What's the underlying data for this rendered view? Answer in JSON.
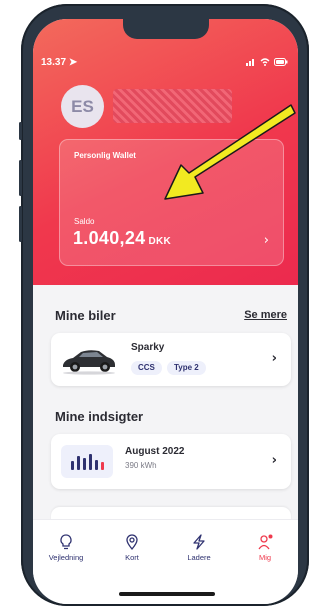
{
  "status": {
    "time": "13.37"
  },
  "profile": {
    "initials": "ES"
  },
  "wallet": {
    "title": "Personlig Wallet",
    "saldo_label": "Saldo",
    "amount": "1.040,24",
    "currency": "DKK"
  },
  "cars": {
    "section_title": "Mine biler",
    "see_more": "Se mere",
    "items": [
      {
        "name": "Sparky",
        "tags": [
          "CCS",
          "Type 2"
        ]
      }
    ]
  },
  "insights": {
    "section_title": "Mine indsigter",
    "items": [
      {
        "title": "August 2022",
        "subtitle": "390 kWh"
      }
    ]
  },
  "tabbar": {
    "items": [
      {
        "label": "Vejledning",
        "icon": "lightbulb-icon"
      },
      {
        "label": "Kort",
        "icon": "map-pin-icon"
      },
      {
        "label": "Ladere",
        "icon": "lightning-icon"
      },
      {
        "label": "Mig",
        "icon": "profile-icon"
      }
    ]
  },
  "colors": {
    "accent": "#ef3a4d",
    "nav": "#2f3270",
    "annotation_arrow": "#f2ea21"
  }
}
